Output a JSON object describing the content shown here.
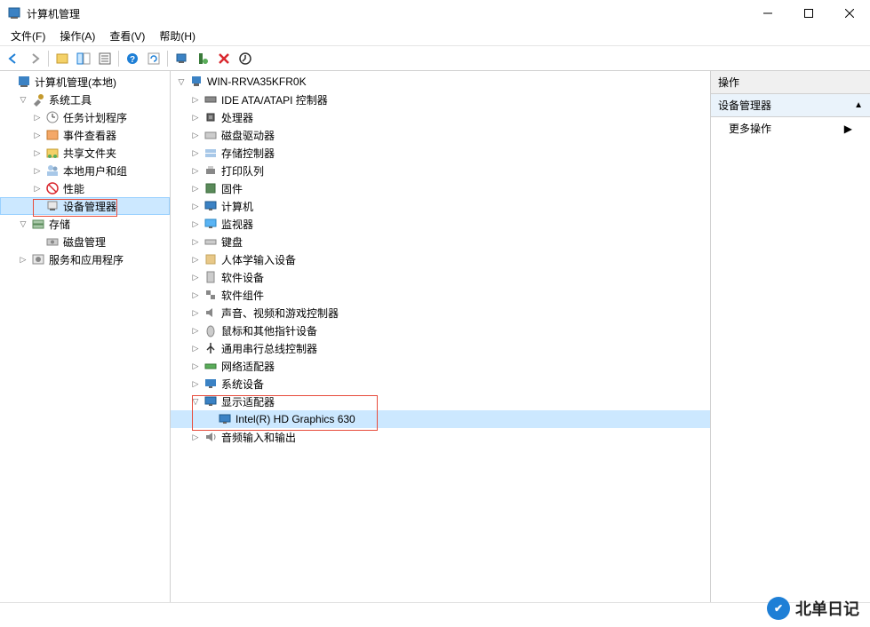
{
  "window": {
    "title": "计算机管理"
  },
  "menu": {
    "file": "文件(F)",
    "action": "操作(A)",
    "view": "查看(V)",
    "help": "帮助(H)"
  },
  "left_tree": {
    "root": "计算机管理(本地)",
    "system_tools": "系统工具",
    "task_scheduler": "任务计划程序",
    "event_viewer": "事件查看器",
    "shared_folders": "共享文件夹",
    "local_users": "本地用户和组",
    "performance": "性能",
    "device_manager": "设备管理器",
    "storage": "存储",
    "disk_management": "磁盘管理",
    "services_apps": "服务和应用程序"
  },
  "device_tree": {
    "computer": "WIN-RRVA35KFR0K",
    "ide": "IDE ATA/ATAPI 控制器",
    "processors": "处理器",
    "disk_drives": "磁盘驱动器",
    "storage_ctrl": "存储控制器",
    "printers": "打印队列",
    "firmware": "固件",
    "computers": "计算机",
    "monitors": "监视器",
    "keyboards": "键盘",
    "hid": "人体学输入设备",
    "software_dev": "软件设备",
    "software_comp": "软件组件",
    "sound": "声音、视频和游戏控制器",
    "mice": "鼠标和其他指针设备",
    "usb": "通用串行总线控制器",
    "network": "网络适配器",
    "system_dev": "系统设备",
    "display": "显示适配器",
    "display_child": "Intel(R) HD Graphics 630",
    "audio_io": "音频输入和输出"
  },
  "actions": {
    "header": "操作",
    "device_mgr": "设备管理器",
    "more": "更多操作"
  },
  "watermark": {
    "text": "北单日记"
  }
}
